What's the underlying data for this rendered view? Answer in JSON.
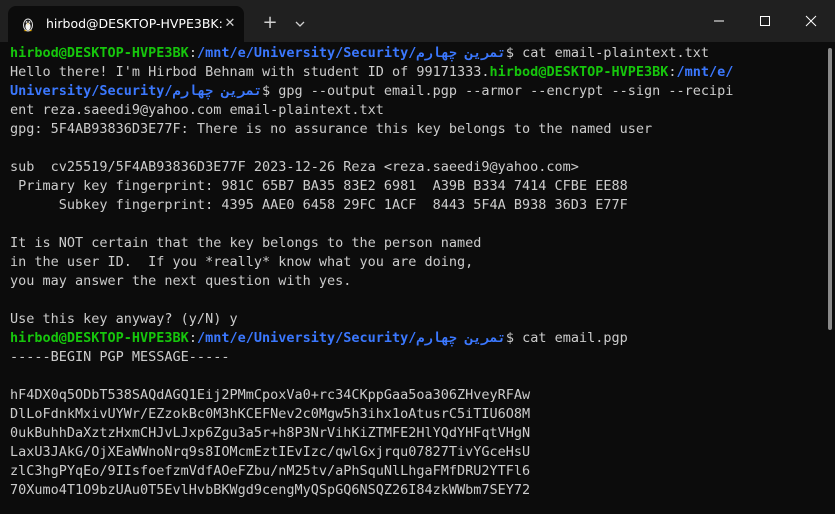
{
  "tab": {
    "title": "hirbod@DESKTOP-HVPE3BK: ",
    "close": "✕"
  },
  "new_tab": "+",
  "terminal": {
    "lines": [
      [
        {
          "t": "hirbod@DESKTOP-HVPE3BK",
          "c": "g"
        },
        {
          "t": ":",
          "c": "w"
        },
        {
          "t": "/mnt/e/University/Security/تمرین چهارم",
          "c": "b"
        },
        {
          "t": "$ cat email-plaintext.txt",
          "c": "w"
        }
      ],
      [
        {
          "t": "Hello there! I'm Hirbod Behnam with student ID of 99171333.",
          "c": "w"
        },
        {
          "t": "hirbod@DESKTOP-HVPE3BK",
          "c": "g"
        },
        {
          "t": ":",
          "c": "w"
        },
        {
          "t": "/mnt/e/",
          "c": "b"
        }
      ],
      [
        {
          "t": "University/Security/تمرین چهارم",
          "c": "b"
        },
        {
          "t": "$ gpg --output email.pgp --armor --encrypt --sign --recipi",
          "c": "w"
        }
      ],
      [
        {
          "t": "ent reza.saeedi9@yahoo.com email-plaintext.txt",
          "c": "w"
        }
      ],
      [
        {
          "t": "gpg: 5F4AB93836D3E77F: There is no assurance this key belongs to the named user",
          "c": "w"
        }
      ],
      [
        {
          "t": "",
          "c": "w"
        }
      ],
      [
        {
          "t": "sub  cv25519/5F4AB93836D3E77F 2023-12-26 Reza <reza.saeedi9@yahoo.com>",
          "c": "w"
        }
      ],
      [
        {
          "t": " Primary key fingerprint: 981C 65B7 BA35 83E2 6981  A39B B334 7414 CFBE EE88",
          "c": "w"
        }
      ],
      [
        {
          "t": "      Subkey fingerprint: 4395 AAE0 6458 29FC 1ACF  8443 5F4A B938 36D3 E77F",
          "c": "w"
        }
      ],
      [
        {
          "t": "",
          "c": "w"
        }
      ],
      [
        {
          "t": "It is NOT certain that the key belongs to the person named",
          "c": "w"
        }
      ],
      [
        {
          "t": "in the user ID.  If you *really* know what you are doing,",
          "c": "w"
        }
      ],
      [
        {
          "t": "you may answer the next question with yes.",
          "c": "w"
        }
      ],
      [
        {
          "t": "",
          "c": "w"
        }
      ],
      [
        {
          "t": "Use this key anyway? (y/N) y",
          "c": "w"
        }
      ],
      [
        {
          "t": "hirbod@DESKTOP-HVPE3BK",
          "c": "g"
        },
        {
          "t": ":",
          "c": "w"
        },
        {
          "t": "/mnt/e/University/Security/تمرین چهارم",
          "c": "b"
        },
        {
          "t": "$ cat email.pgp",
          "c": "w"
        }
      ],
      [
        {
          "t": "-----BEGIN PGP MESSAGE-----",
          "c": "w"
        }
      ],
      [
        {
          "t": "",
          "c": "w"
        }
      ],
      [
        {
          "t": "hF4DX0q5ODbT538SAQdAGQ1Eij2PMmCpoxVa0+rc34CKppGaa5oa306ZHveyRFAw",
          "c": "w"
        }
      ],
      [
        {
          "t": "DlLoFdnkMxivUYWr/EZzokBc0M3hKCEFNev2c0Mgw5h3ihx1oAtusrC5iTIU6O8M",
          "c": "w"
        }
      ],
      [
        {
          "t": "0ukBuhhDaXztzHxmCHJvLJxp6Zgu3a5r+h8P3NrVihKiZTMFE2HlYQdYHFqtVHgN",
          "c": "w"
        }
      ],
      [
        {
          "t": "LaxU3JAkG/OjXEaWWnoNrq9s8IOMcmEztIEvIzc/qwlGxjrqu07827TivYGceHsU",
          "c": "w"
        }
      ],
      [
        {
          "t": "zlC3hgPYqEo/9IIsfoefzmVdfAOeFZbu/nM25tv/aPhSquNlLhgaFMfDRU2YTFl6",
          "c": "w"
        }
      ],
      [
        {
          "t": "70Xumo4T1O9bzUAu0T5EvlHvbBKWgd9cengMyQSpGQ6NSQZ26I84zkWWbm7SEY72",
          "c": "w"
        }
      ]
    ]
  }
}
